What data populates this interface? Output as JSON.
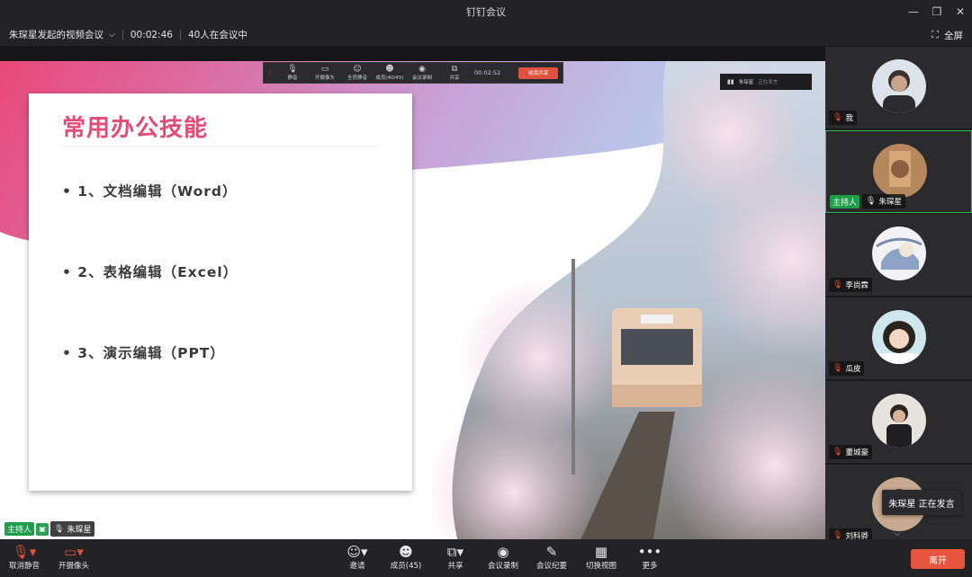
{
  "window": {
    "title": "钉钉会议",
    "minimize": "—",
    "restore": "❐",
    "close": "✕"
  },
  "info": {
    "meeting_title": "朱琛星发起的视频会议",
    "elapsed": "00:02:46",
    "attendees": "40人在会议中",
    "fullscreen_label": "全屏"
  },
  "slide": {
    "heading": "常用办公技能",
    "items": [
      "• 1、文档编辑（Word）",
      "• 2、表格编辑（Excel）",
      "• 3、演示编辑（PPT）"
    ]
  },
  "share_bar": {
    "items": [
      "静音",
      "开摄像头",
      "全员静音",
      "成员(40/45)",
      "会议录制",
      "共享"
    ],
    "timer": "00:02:52",
    "stop_label": "结束共享"
  },
  "speak_pill": {
    "name": "朱琛星",
    "status": "正在发言"
  },
  "main_host": {
    "badge": "主持人",
    "name": "朱琛星"
  },
  "participants": [
    {
      "name": "我",
      "mic": "muted"
    },
    {
      "name": "朱琛星",
      "host_badge": "主持人",
      "mic": "on",
      "active": true
    },
    {
      "name": "李尚霖",
      "mic": "muted"
    },
    {
      "name": "瓜皮",
      "mic": "muted"
    },
    {
      "name": "董城豪",
      "mic": "muted"
    },
    {
      "name": "刘科骅",
      "mic": "muted"
    }
  ],
  "speaking_tip": "朱琛星  正在发言",
  "toolbar": {
    "unmute": "取消静音",
    "camera": "开摄像头",
    "invite": "邀请",
    "members": "成员(45)",
    "share": "共享",
    "record": "会议录制",
    "minutes": "会议纪要",
    "view": "切换视图",
    "more": "更多",
    "leave": "离开"
  },
  "colors": {
    "accent_red": "#e0523d",
    "host_green": "#1e9e4a",
    "heading_pink": "#e34b78"
  }
}
